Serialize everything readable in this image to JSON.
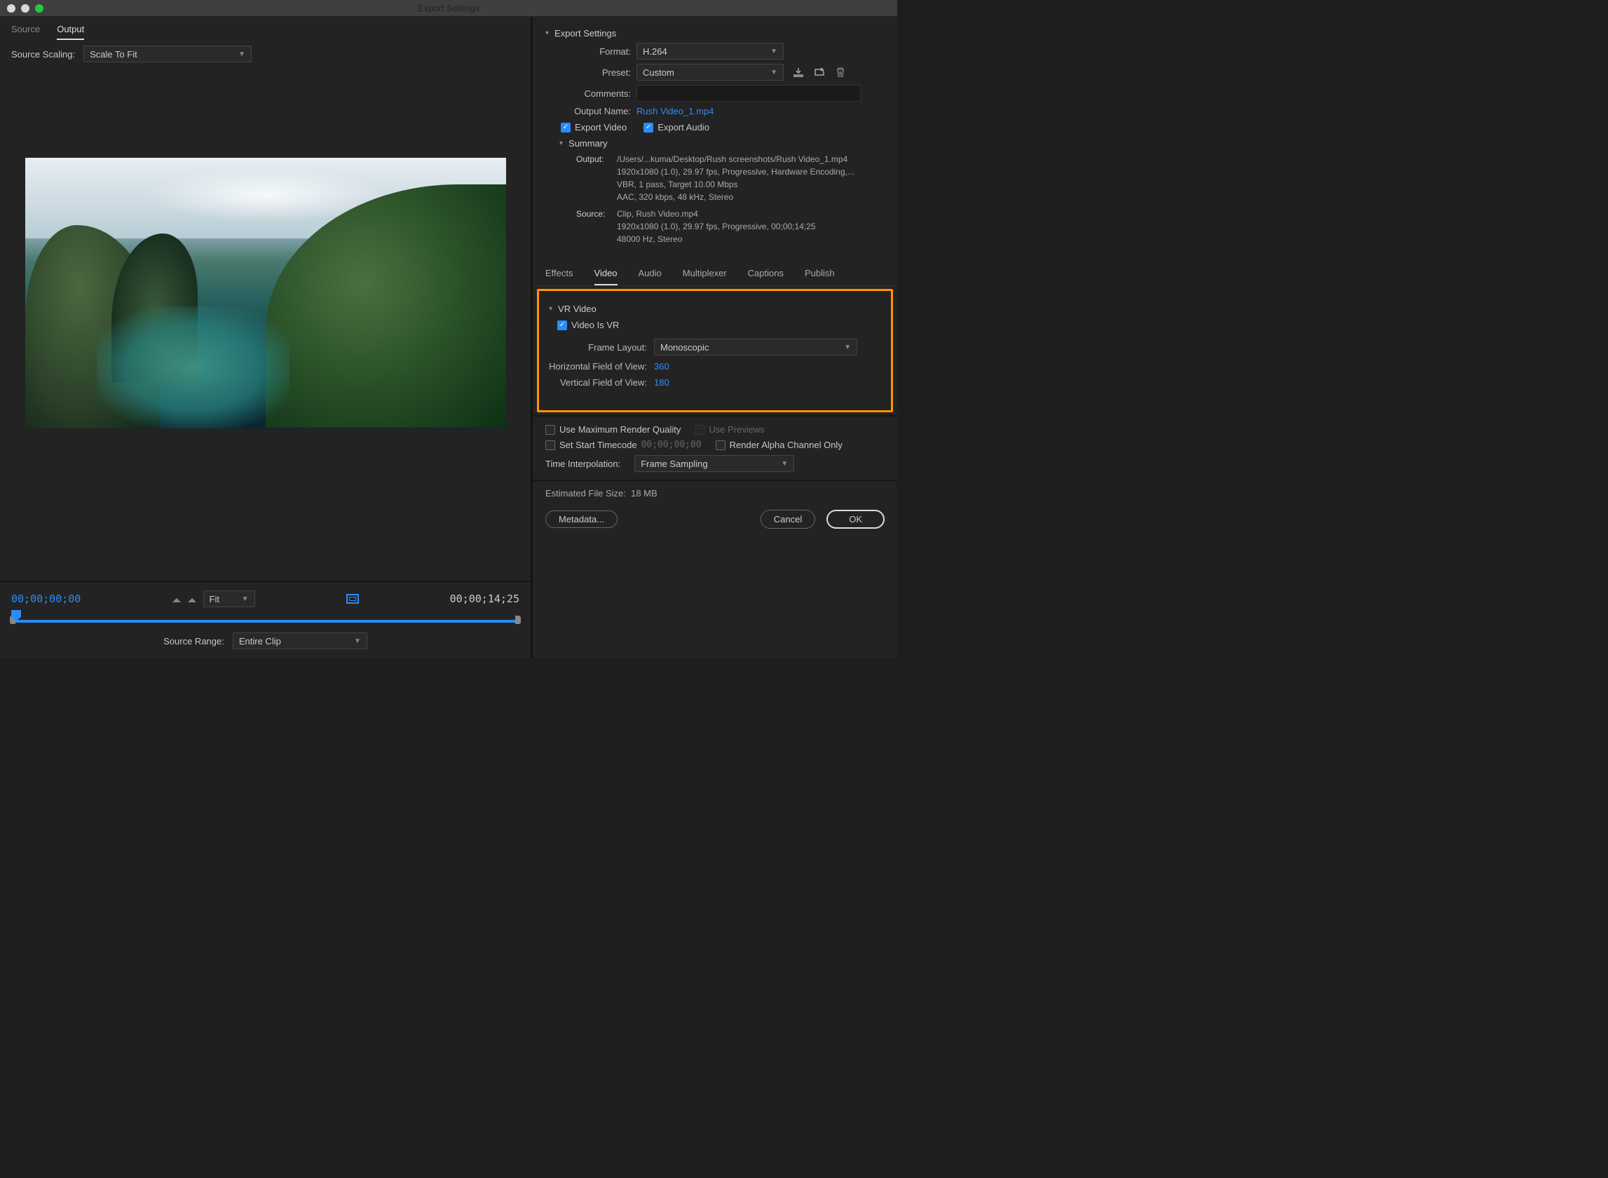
{
  "window": {
    "title": "Export Settings"
  },
  "leftTabs": {
    "source": "Source",
    "output": "Output"
  },
  "sourceScaling": {
    "label": "Source Scaling:",
    "value": "Scale To Fit"
  },
  "timeline": {
    "inPoint": "00;00;00;00",
    "outPoint": "00;00;14;25",
    "fitLabel": "Fit",
    "sourceRangeLabel": "Source Range:",
    "sourceRangeValue": "Entire Clip"
  },
  "exportSettings": {
    "header": "Export Settings",
    "formatLabel": "Format:",
    "formatValue": "H.264",
    "presetLabel": "Preset:",
    "presetValue": "Custom",
    "commentsLabel": "Comments:",
    "outputNameLabel": "Output Name:",
    "outputNameValue": "Rush Video_1.mp4",
    "exportVideo": "Export Video",
    "exportAudio": "Export Audio",
    "summaryLabel": "Summary",
    "outputLabel": "Output:",
    "outLine1": "/Users/...kuma/Desktop/Rush screenshots/Rush Video_1.mp4",
    "outLine2": "1920x1080 (1.0), 29.97 fps, Progressive, Hardware Encoding,...",
    "outLine3": "VBR, 1 pass, Target 10.00 Mbps",
    "outLine4": "AAC, 320 kbps, 48 kHz, Stereo",
    "sourceLabel": "Source:",
    "srcLine1": "Clip, Rush Video.mp4",
    "srcLine2": "1920x1080 (1.0), 29.97 fps, Progressive, 00;00;14;25",
    "srcLine3": "48000 Hz, Stereo"
  },
  "tabs": {
    "effects": "Effects",
    "video": "Video",
    "audio": "Audio",
    "mux": "Multiplexer",
    "captions": "Captions",
    "publish": "Publish"
  },
  "vr": {
    "header": "VR Video",
    "videoIsVr": "Video Is VR",
    "frameLayoutLabel": "Frame Layout:",
    "frameLayoutValue": "Monoscopic",
    "hfovLabel": "Horizontal Field of View:",
    "hfovValue": "360",
    "vfovLabel": "Vertical Field of View:",
    "vfovValue": "180"
  },
  "renderOpts": {
    "maxQuality": "Use Maximum Render Quality",
    "usePreviews": "Use Previews",
    "setStartTc": "Set Start Timecode",
    "startTc": "00;00;00;00",
    "renderAlpha": "Render Alpha Channel Only",
    "timeInterpLabel": "Time Interpolation:",
    "timeInterpValue": "Frame Sampling"
  },
  "estimated": {
    "label": "Estimated File Size:",
    "value": "18 MB"
  },
  "buttons": {
    "metadata": "Metadata...",
    "cancel": "Cancel",
    "ok": "OK"
  }
}
